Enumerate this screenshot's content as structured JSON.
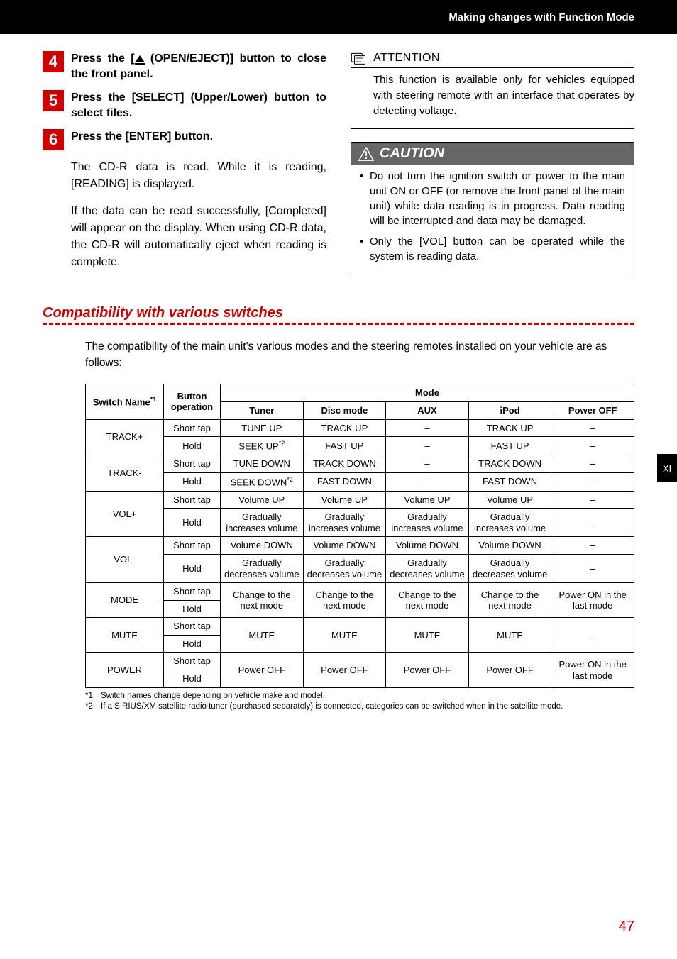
{
  "header": {
    "title": "Making changes with Function Mode"
  },
  "side_tab": "XI",
  "page_number": "47",
  "left": {
    "steps": [
      {
        "num": "4",
        "text_before": "Press the [",
        "text_after": " (OPEN/EJECT)] button to close the front panel.",
        "icon": "eject-icon"
      },
      {
        "num": "5",
        "text": "Press the [SELECT] (Upper/Lower) button to select files."
      },
      {
        "num": "6",
        "text": "Press the [ENTER] button."
      }
    ],
    "explain1": "The CD-R data is read. While it is reading, [READING] is displayed.",
    "explain2": "If the data can be read successfully, [Completed] will appear on the display. When using CD-R data, the CD-R will automatically eject when reading is complete."
  },
  "right": {
    "attention_title": "ATTENTION",
    "attention_body": "This function is available only for vehicles equipped with steering remote with an interface that operates by detecting voltage.",
    "caution_title": "CAUTION",
    "caution_items": [
      "Do not turn the ignition switch or power to the main unit ON or OFF (or remove the front panel of the main unit) while data reading is in progress. Data reading will be interrupted and data may be damaged.",
      "Only the [VOL] button can be operated while the system is reading data."
    ]
  },
  "compat": {
    "title": "Compatibility with various switches",
    "intro": "The compatibility of the main unit's various modes and the steering remotes installed on your vehicle are as follows:",
    "headers": {
      "switch_name": "Switch Name",
      "switch_sup": "*1",
      "button_op": "Button operation",
      "mode": "Mode",
      "tuner": "Tuner",
      "disc": "Disc mode",
      "aux": "AUX",
      "ipod": "iPod",
      "poweroff": "Power OFF"
    },
    "rows": {
      "track_plus": {
        "name": "TRACK+",
        "short": [
          "TUNE UP",
          "TRACK UP",
          "–",
          "TRACK UP",
          "–"
        ],
        "hold_tuner": "SEEK UP",
        "hold_tuner_sup": "*2",
        "hold_rest": [
          "FAST UP",
          "–",
          "FAST UP",
          "–"
        ]
      },
      "track_minus": {
        "name": "TRACK-",
        "short": [
          "TUNE DOWN",
          "TRACK DOWN",
          "–",
          "TRACK DOWN",
          "–"
        ],
        "hold_tuner": "SEEK DOWN",
        "hold_tuner_sup": "*2",
        "hold_rest": [
          "FAST DOWN",
          "–",
          "FAST DOWN",
          "–"
        ]
      },
      "vol_plus": {
        "name": "VOL+",
        "short": [
          "Volume UP",
          "Volume UP",
          "Volume UP",
          "Volume UP",
          "–"
        ],
        "hold": [
          "Gradually increases volume",
          "Gradually increases volume",
          "Gradually increases volume",
          "Gradually increases volume",
          "–"
        ]
      },
      "vol_minus": {
        "name": "VOL-",
        "short": [
          "Volume DOWN",
          "Volume DOWN",
          "Volume DOWN",
          "Volume DOWN",
          "–"
        ],
        "hold": [
          "Gradually decreases volume",
          "Gradually decreases volume",
          "Gradually decreases volume",
          "Gradually decreases volume",
          "–"
        ]
      },
      "mode": {
        "name": "MODE",
        "merged": [
          "Change to the next mode",
          "Change to the next mode",
          "Change to the next mode",
          "Change to the next mode",
          "Power ON in the last mode"
        ]
      },
      "mute": {
        "name": "MUTE",
        "merged": [
          "MUTE",
          "MUTE",
          "MUTE",
          "MUTE",
          "–"
        ]
      },
      "power": {
        "name": "POWER",
        "merged": [
          "Power OFF",
          "Power OFF",
          "Power OFF",
          "Power OFF",
          "Power ON in the last mode"
        ]
      }
    },
    "ops": {
      "short": "Short tap",
      "hold": "Hold"
    },
    "footnotes": {
      "f1_mark": "*1:",
      "f1": "Switch names change depending on vehicle make and model.",
      "f2_mark": "*2:",
      "f2": "If a SIRIUS/XM satellite radio tuner (purchased separately) is connected, categories can be switched when in the satellite mode."
    }
  }
}
